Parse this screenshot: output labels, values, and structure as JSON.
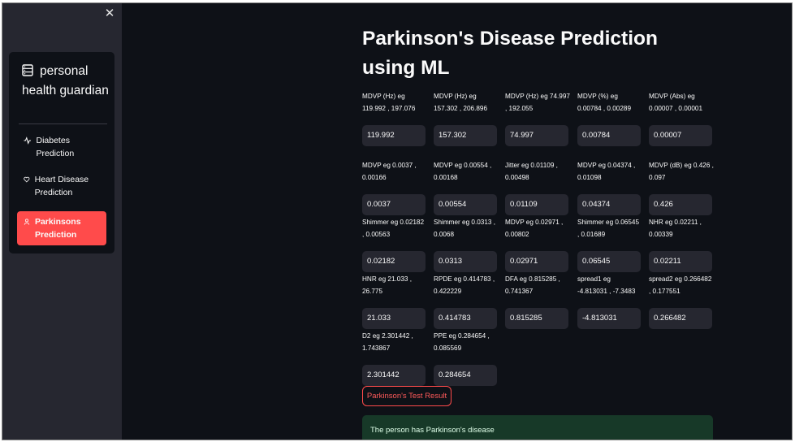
{
  "sidebar": {
    "close_icon": "close-icon",
    "menu": {
      "title": "personal health guardian",
      "title_icon": "database-icon",
      "items": [
        {
          "label": "Diabetes Prediction",
          "icon": "activity-icon",
          "selected": false
        },
        {
          "label": "Heart Disease Prediction",
          "icon": "heart-icon",
          "selected": false
        },
        {
          "label": "Parkinsons Prediction",
          "icon": "person-icon",
          "selected": true
        }
      ]
    }
  },
  "main": {
    "title": "Parkinson's Disease Prediction using ML",
    "fields": [
      {
        "label": "MDVP (Hz) eg 119.992 , 197.076",
        "value": "119.992"
      },
      {
        "label": "MDVP (Hz) eg 157.302 , 206.896",
        "value": "157.302"
      },
      {
        "label": "MDVP (Hz) eg 74.997 , 192.055",
        "value": "74.997"
      },
      {
        "label": "MDVP (%) eg 0.00784 , 0.00289",
        "value": "0.00784"
      },
      {
        "label": "MDVP (Abs) eg 0.00007 , 0.00001",
        "value": "0.00007"
      },
      {
        "label": "MDVP eg 0.0037 , 0.00166",
        "value": "0.0037"
      },
      {
        "label": "MDVP eg 0.00554 , 0.00168",
        "value": "0.00554"
      },
      {
        "label": "Jitter eg 0.01109 , 0.00498",
        "value": "0.01109"
      },
      {
        "label": "MDVP eg 0.04374 , 0.01098",
        "value": "0.04374"
      },
      {
        "label": "MDVP (dB) eg 0.426 , 0.097",
        "value": "0.426"
      },
      {
        "label": "Shimmer eg 0.02182 , 0.00563",
        "value": "0.02182"
      },
      {
        "label": "Shimmer eg 0.0313 , 0.0068",
        "value": "0.0313"
      },
      {
        "label": "MDVP eg 0.02971 , 0.00802",
        "value": "0.02971"
      },
      {
        "label": "Shimmer eg 0.06545 , 0.01689",
        "value": "0.06545"
      },
      {
        "label": "NHR eg 0.02211 , 0.00339",
        "value": "0.02211"
      },
      {
        "label": "HNR eg 21.033 , 26.775",
        "value": "21.033"
      },
      {
        "label": "RPDE eg 0.414783 , 0.422229",
        "value": "0.414783"
      },
      {
        "label": "DFA eg 0.815285 , 0.741367",
        "value": "0.815285"
      },
      {
        "label": "spread1 eg -4.813031 , -7.3483",
        "value": "-4.813031"
      },
      {
        "label": "spread2 eg 0.266482 , 0.177551",
        "value": "0.266482"
      },
      {
        "label": "D2 eg 2.301442 , 1.743867",
        "value": "2.301442"
      },
      {
        "label": "PPE eg 0.284654 , 0.085569",
        "value": "0.284654"
      }
    ],
    "button_label": "Parkinson's Test Result",
    "result_text": "The person has Parkinson's disease"
  },
  "colors": {
    "background": "#0e1117",
    "sidebar": "#262730",
    "accent": "#ff4b4b",
    "input_bg": "#262730",
    "success_bg": "#173928"
  }
}
